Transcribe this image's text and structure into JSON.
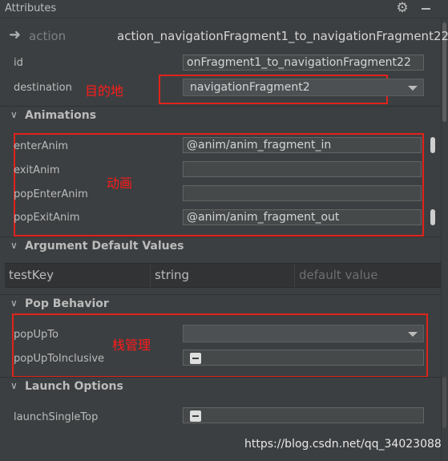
{
  "panel": {
    "title": "Attributes"
  },
  "action": {
    "label": "action",
    "value": "action_navigationFragment1_to_navigationFragment22"
  },
  "fields": {
    "id_label": "id",
    "id_value": "onFragment1_to_navigationFragment22",
    "destination_label": "destination",
    "destination_value": "navigationFragment2"
  },
  "annotations": {
    "destination_note": "目的地",
    "animations_note": "动画",
    "pop_note": "栈管理"
  },
  "sections": {
    "animations": "Animations",
    "argument_defaults": "Argument Default Values",
    "pop_behavior": "Pop Behavior",
    "launch_options": "Launch Options"
  },
  "animations": {
    "enter_label": "enterAnim",
    "enter_value": "@anim/anim_fragment_in",
    "exit_label": "exitAnim",
    "exit_value": "",
    "pop_enter_label": "popEnterAnim",
    "pop_enter_value": "",
    "pop_exit_label": "popExitAnim",
    "pop_exit_value": "@anim/anim_fragment_out"
  },
  "arguments": {
    "rows": [
      {
        "name": "testKey",
        "type": "string",
        "default_placeholder": "default value"
      }
    ]
  },
  "pop_behavior": {
    "pop_up_to_label": "popUpTo",
    "pop_up_to_value": "",
    "pop_up_to_inclusive_label": "popUpToInclusive"
  },
  "launch": {
    "single_top_label": "launchSingleTop"
  },
  "watermark": "https://blog.csdn.net/qq_34023088",
  "colors": {
    "background": "#3c3f41",
    "field": "#45494a",
    "annotation_red": "#e0231c",
    "text": "#bbbbbb"
  }
}
